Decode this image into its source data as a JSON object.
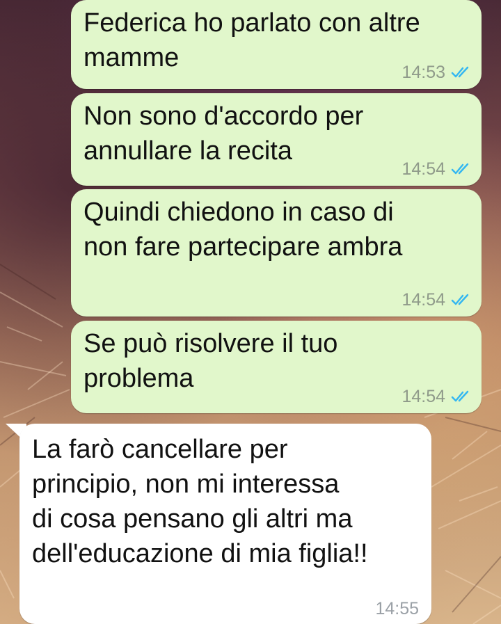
{
  "chat": {
    "messages": [
      {
        "direction": "outgoing",
        "text": "Federica ho parlato con altre\nmamme",
        "time": "14:53",
        "status_icon": "double-check-read-icon"
      },
      {
        "direction": "outgoing",
        "text": "Non sono d'accordo per\nannullare la recita",
        "time": "14:54",
        "status_icon": "double-check-read-icon"
      },
      {
        "direction": "outgoing",
        "text": "Quindi chiedono in caso di\nnon fare partecipare ambra",
        "time": "14:54",
        "status_icon": "double-check-read-icon"
      },
      {
        "direction": "outgoing",
        "text": "Se può risolvere il tuo\nproblema",
        "time": "14:54",
        "status_icon": "double-check-read-icon"
      },
      {
        "direction": "incoming",
        "text": "La farò cancellare per\nprincipio, non mi interessa\ndi cosa pensano gli altri ma\ndell'educazione di mia figlia!!",
        "time": "14:55"
      }
    ]
  },
  "colors": {
    "outgoing_bubble": "#e1f7cb",
    "incoming_bubble": "#ffffff",
    "read_ticks": "#34b7f1",
    "timestamp": "#8f9a8a"
  }
}
